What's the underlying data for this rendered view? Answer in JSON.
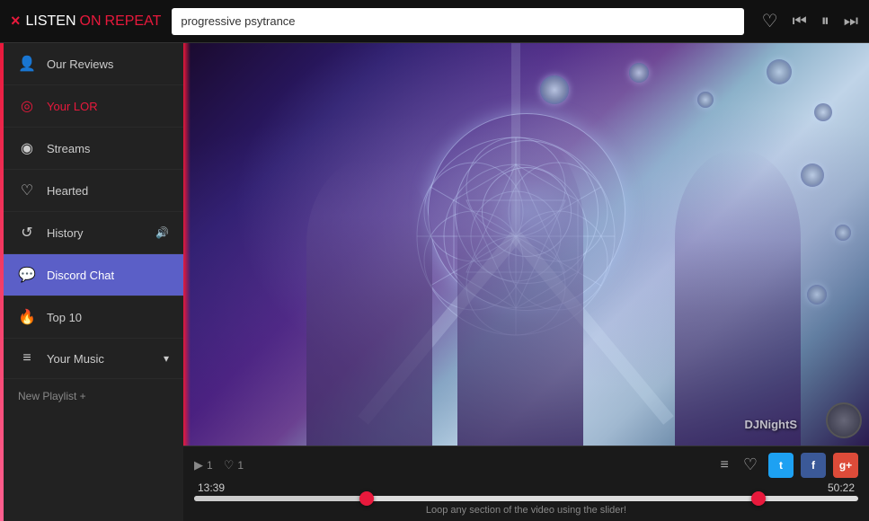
{
  "header": {
    "logo": {
      "x": "×",
      "listen": "LISTEN",
      "on": "ON",
      "repeat": "REPEAT"
    },
    "search_placeholder": "progressive psytrance",
    "icons": {
      "heart": "♡",
      "prev": "⏮",
      "play_pause": "⏸",
      "next": "⏭"
    }
  },
  "sidebar": {
    "items": [
      {
        "id": "our-reviews",
        "label": "Our Reviews",
        "icon": "👤",
        "active": false,
        "pink": false
      },
      {
        "id": "your-lor",
        "label": "Your LOR",
        "icon": "◎",
        "active": false,
        "pink": true
      },
      {
        "id": "streams",
        "label": "Streams",
        "icon": "◉",
        "active": false,
        "pink": false
      },
      {
        "id": "hearted",
        "label": "Hearted",
        "icon": "♡",
        "active": false,
        "pink": false
      },
      {
        "id": "history",
        "label": "History",
        "icon": "↺",
        "active": false,
        "pink": false
      },
      {
        "id": "discord-chat",
        "label": "Discord Chat",
        "icon": "💬",
        "active": true,
        "pink": false
      },
      {
        "id": "top-10",
        "label": "Top 10",
        "icon": "🔥",
        "active": false,
        "pink": false
      },
      {
        "id": "your-music",
        "label": "Your Music",
        "icon": "≡",
        "active": false,
        "pink": false,
        "has_chevron": true
      }
    ],
    "new_playlist_label": "New Playlist +"
  },
  "player": {
    "user_count_play": "1",
    "user_count_heart": "1",
    "time_current": "13:39",
    "time_total": "50:22",
    "progress_percent": 26,
    "end_percent": 85,
    "hint": "Loop any section of the video using the slider!",
    "watermark": "DJNightS",
    "buttons": {
      "queue": "≡",
      "heart": "♡",
      "twitter": "t",
      "facebook": "f",
      "gplus": "g+"
    }
  }
}
